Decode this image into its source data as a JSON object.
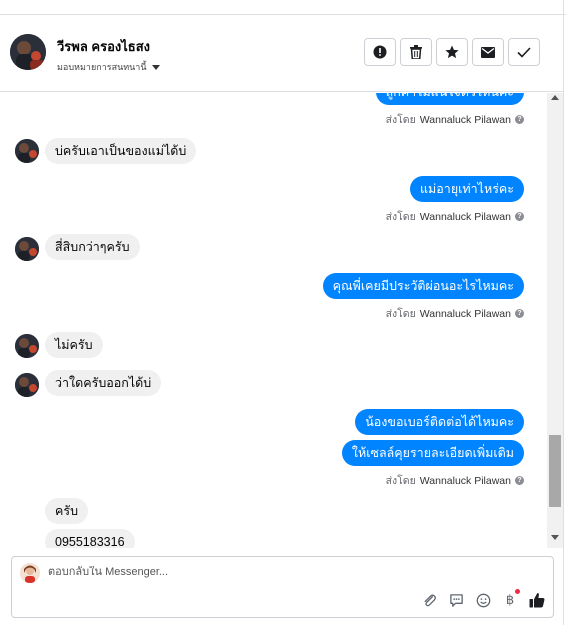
{
  "header": {
    "contact_name": "วีรพล ครองไธสง",
    "assignee_label": "มอบหมายการสนทนานี้"
  },
  "actions": [
    {
      "icon": "alert-icon",
      "label": "mark-spam"
    },
    {
      "icon": "trash-icon",
      "label": "delete"
    },
    {
      "icon": "star-icon",
      "label": "star"
    },
    {
      "icon": "envelope-icon",
      "label": "mark-unread"
    },
    {
      "icon": "checkmark-icon",
      "label": "mark-done"
    }
  ],
  "thread": {
    "messages": [
      {
        "from": "page",
        "text": "ลูกค้าไม่แน่ใจตัวไหนคะ"
      },
      {
        "from": "page",
        "sent_by_prefix": "ส่งโดย",
        "sent_by_name": "Wannaluck Pilawan"
      },
      {
        "from": "contact",
        "text": "บ่ครับเอาเป็นของแม่ได้บ่"
      },
      {
        "from": "page",
        "text": "แม่อายุเท่าไหร่คะ"
      },
      {
        "from": "page",
        "sent_by_prefix": "ส่งโดย",
        "sent_by_name": "Wannaluck Pilawan"
      },
      {
        "from": "contact",
        "text": "สี่สิบกว่าๆครับ"
      },
      {
        "from": "page",
        "text": "คุณพี่เคยมีประวัติผ่อนอะไรไหมคะ"
      },
      {
        "from": "page",
        "sent_by_prefix": "ส่งโดย",
        "sent_by_name": "Wannaluck Pilawan"
      },
      {
        "from": "contact",
        "text": "ไม่ครับ"
      },
      {
        "from": "contact",
        "text": "ว่าใดครับออกได้บ่"
      },
      {
        "from": "page",
        "text": "น้องขอเบอร์ติดต่อได้ไหมคะ"
      },
      {
        "from": "page",
        "text": "ให้เซลล์คุยรายละเอียดเพิ่มเติม"
      },
      {
        "from": "page",
        "sent_by_prefix": "ส่งโดย",
        "sent_by_name": "Wannaluck Pilawan"
      },
      {
        "from": "contact",
        "text": "ครับ"
      },
      {
        "from": "contact",
        "text": "0955183316"
      }
    ]
  },
  "composer": {
    "placeholder": "ตอบกลับใน Messenger...",
    "currency_symbol": "฿"
  },
  "colors": {
    "accent": "#0084ff",
    "incoming_bubble": "#f0f0f0",
    "notification_dot": "#f02849"
  }
}
